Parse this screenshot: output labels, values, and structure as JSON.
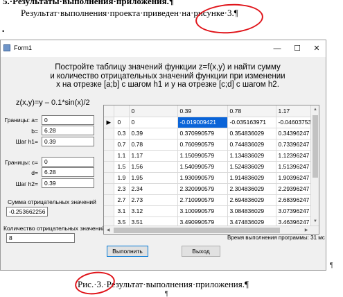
{
  "document": {
    "heading": "5.·Результаты·выполнения·приложения.¶",
    "intro": "Результат·выполнения·проекта·приведен·на·рисунке·3.¶",
    "caption": "Рис.·3.·Результат·выполнения·приложения.¶",
    "marks": {
      "pilcrow": "¶",
      "bullet": "▪"
    }
  },
  "window": {
    "title": "Form1",
    "controls": {
      "minimize": "—",
      "maximize": "☐",
      "close": "✕"
    }
  },
  "task": {
    "line1": "Постройте таблицу значений функции z=f(x,y) и найти сумму",
    "line2": "и количество отрицательных значений функции при изменении",
    "line3": "x на отрезке [a;b] с шагом h1 и у на отрезке [c;d] с шагом h2."
  },
  "formula": "z(x,y)=y – 0.1*sin(x)/2",
  "inputs": {
    "a": {
      "label": "Границы: а=",
      "value": "0"
    },
    "b": {
      "label": "b=",
      "value": "6.28"
    },
    "h1": {
      "label": "Шаг h1=",
      "value": "0.39"
    },
    "c": {
      "label": "Границы: с=",
      "value": "0"
    },
    "d": {
      "label": "d=",
      "value": "6.28"
    },
    "h2": {
      "label": "Шаг h2=",
      "value": "0.39"
    }
  },
  "results": {
    "sum_label": "Сумма отрицательных значений",
    "sum_value": "-0.253662256",
    "count_label": "Количество отрицательных значений",
    "count_value": "8"
  },
  "grid": {
    "columns": [
      "",
      "",
      "0",
      "0.39",
      "0.78",
      "1.17"
    ],
    "rows": [
      {
        "pointer": "▶",
        "label": "0",
        "cells": [
          "0",
          "-0.019009421",
          "-0.035163971",
          "-0.04603753"
        ]
      },
      {
        "pointer": "",
        "label": "0.3",
        "cells": [
          "0.39",
          "0.370990579",
          "0.354836029",
          "0.34396247"
        ]
      },
      {
        "pointer": "",
        "label": "0.7",
        "cells": [
          "0.78",
          "0.760990579",
          "0.744836029",
          "0.73396247"
        ]
      },
      {
        "pointer": "",
        "label": "1.1",
        "cells": [
          "1.17",
          "1.150990579",
          "1.134836029",
          "1.12396247"
        ]
      },
      {
        "pointer": "",
        "label": "1.5",
        "cells": [
          "1.56",
          "1.540990579",
          "1.524836029",
          "1.51396247"
        ]
      },
      {
        "pointer": "",
        "label": "1.9",
        "cells": [
          "1.95",
          "1.930990579",
          "1.914836029",
          "1.90396247"
        ]
      },
      {
        "pointer": "",
        "label": "2.3",
        "cells": [
          "2.34",
          "2.320990579",
          "2.304836029",
          "2.29396247"
        ]
      },
      {
        "pointer": "",
        "label": "2.7",
        "cells": [
          "2.73",
          "2.710990579",
          "2.694836029",
          "2.68396247"
        ]
      },
      {
        "pointer": "",
        "label": "3.1",
        "cells": [
          "3.12",
          "3.100990579",
          "3.084836029",
          "3.07396247"
        ]
      },
      {
        "pointer": "",
        "label": "3.5",
        "cells": [
          "3.51",
          "3.490990579",
          "3.474836029",
          "3.46396247"
        ]
      }
    ],
    "selected": {
      "row": 0,
      "col": 1
    }
  },
  "status": {
    "time_label": "Время выполнения программы: 31 мс"
  },
  "buttons": {
    "run": "Выполнить",
    "exit": "Выход"
  },
  "colors": {
    "annotation": "#e0141a",
    "selection": "#0a64d8"
  }
}
